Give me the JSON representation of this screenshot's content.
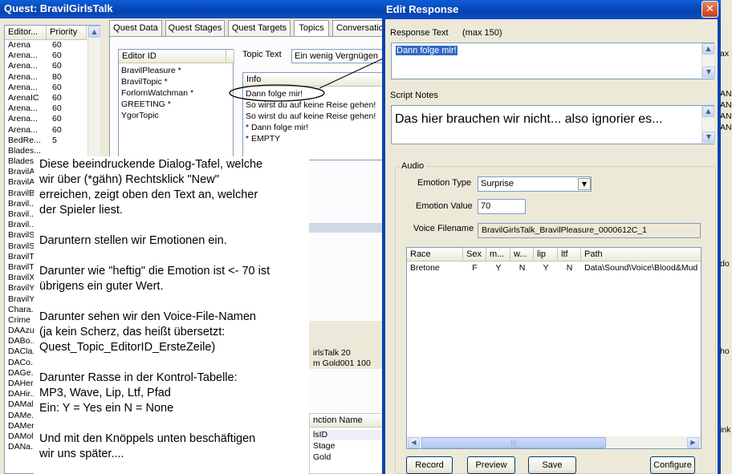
{
  "main_window": {
    "title": "Quest: BravilGirlsTalk"
  },
  "quest_list": {
    "headers": [
      "Editor...",
      "Priority"
    ],
    "rows": [
      [
        "Arena",
        "60"
      ],
      [
        "Arena...",
        "60"
      ],
      [
        "Arena...",
        "60"
      ],
      [
        "Arena...",
        "80"
      ],
      [
        "Arena...",
        "60"
      ],
      [
        "ArenaIC",
        "60"
      ],
      [
        "Arena...",
        "60"
      ],
      [
        "Arena...",
        "60"
      ],
      [
        "Arena...",
        "60"
      ],
      [
        "BedRe...",
        "5"
      ],
      [
        "Blades...",
        ""
      ],
      [
        "Blades...",
        ""
      ],
      [
        "BravilA...",
        ""
      ],
      [
        "BravilA...",
        ""
      ],
      [
        "BravilB...",
        ""
      ],
      [
        "Bravil...",
        ""
      ],
      [
        "Bravil...",
        ""
      ],
      [
        "Bravil...",
        ""
      ],
      [
        "BravilS...",
        ""
      ],
      [
        "BravilS...",
        ""
      ],
      [
        "BravilT...",
        ""
      ],
      [
        "BravilT...",
        ""
      ],
      [
        "BravilX...",
        ""
      ],
      [
        "BravilY...",
        ""
      ],
      [
        "BravilY...",
        ""
      ],
      [
        "Chara...",
        ""
      ],
      [
        "Crime",
        ""
      ],
      [
        "DAAzur...",
        ""
      ],
      [
        "DABo...",
        ""
      ],
      [
        "DACla...",
        ""
      ],
      [
        "DACo...",
        ""
      ],
      [
        "DAGe...",
        ""
      ],
      [
        "DAHer...",
        ""
      ],
      [
        "DAHir...",
        ""
      ],
      [
        "DAMal...",
        ""
      ],
      [
        "DAMe...",
        ""
      ],
      [
        "DAMer...",
        ""
      ],
      [
        "DAMol...",
        ""
      ],
      [
        "DANa...",
        ""
      ]
    ]
  },
  "tabs": [
    "Quest Data",
    "Quest Stages",
    "Quest Targets",
    "Topics",
    "Conversation"
  ],
  "topic_list": {
    "header": "Editor ID",
    "rows": [
      "BravilPleasure *",
      "BravilTopic *",
      "ForlornWatchman *",
      "GREETING *",
      "YgorTopic"
    ]
  },
  "topic_text": {
    "label": "Topic Text",
    "value": "Ein wenig Vergnügen"
  },
  "info_list": {
    "header": "Info",
    "rows": [
      "Dann folge mir!",
      "So wirst du auf keine Reise gehen!",
      "So wirst du auf keine Reise gehen!",
      "* Dann folge mir!",
      "* EMPTY"
    ]
  },
  "bg_fragments": {
    "results": [
      "irlsTalk 20",
      "m Gold001 100"
    ],
    "function_header": "nction Name",
    "function_rows": [
      "lsID",
      "Stage",
      "Gold"
    ]
  },
  "right_edge": [
    "ax 1",
    "AN",
    "AN",
    "AN",
    "AN",
    "do",
    "ho",
    "ink"
  ],
  "annotation": [
    "Diese beeindruckende Dialog-Tafel, welche",
    "wir über (*gähn) Rechtsklick \"New\"",
    "erreichen, zeigt oben den Text an, welcher",
    "der Spieler liest.",
    "",
    "Daruntern stellen wir Emotionen ein.",
    "",
    "Darunter wie \"heftig\" die Emotion ist <- 70 ist",
    "übrigens ein guter Wert.",
    "",
    "Darunter sehen wir den Voice-File-Namen",
    "(ja kein Scherz, das heißt übersetzt:",
    "Quest_Topic_EditorID_ErsteZeile)",
    "",
    "Darunter Rasse in der Kontrol-Tabelle:",
    "MP3, Wave, Lip, Ltf, Pfad",
    "Ein: Y = Yes  ein N = None",
    "",
    "Und mit den Knöppels unten beschäftigen",
    "wir uns später...."
  ],
  "dialog": {
    "title": "Edit Response",
    "close_glyph": "✕",
    "response_text_label": "Response Text",
    "max_label": "(max 150)",
    "response_text_value": "Dann folge mir!",
    "script_notes_label": "Script Notes",
    "script_notes_value": "Das hier brauchen wir nicht... also ignorier es...",
    "audio_label": "Audio",
    "emotion_type_label": "Emotion Type",
    "emotion_type_value": "Surprise",
    "emotion_value_label": "Emotion Value",
    "emotion_value": "70",
    "voice_filename_label": "Voice Filename",
    "voice_filename_value": "BravilGirlsTalk_BravilPleasure_0000612C_1",
    "table_headers": [
      "Race",
      "Sex",
      "m...",
      "w...",
      "lip",
      "ltf",
      "Path"
    ],
    "table_row": [
      "Bretone",
      "F",
      "Y",
      "N",
      "Y",
      "N",
      "Data\\Sound\\Voice\\Blood&Mud"
    ],
    "buttons": {
      "record": "Record",
      "preview": "Preview",
      "save": "Save",
      "configure": "Configure"
    }
  },
  "colors": {
    "titlebar": "#0842b0",
    "dialog_bg": "#ece9d8",
    "highlight": "#316ac5",
    "ellipse": "#000000"
  }
}
